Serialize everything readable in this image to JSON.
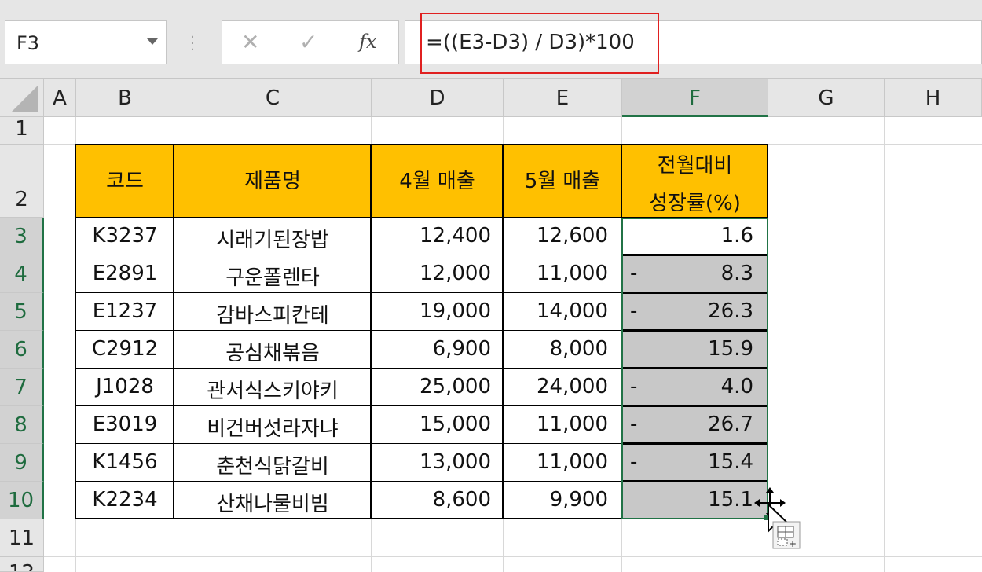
{
  "name_box": "F3",
  "formula_bar": {
    "cancel_icon": "✕",
    "enter_icon": "✓",
    "fx_label": "fx",
    "formula": "=((E3-D3) / D3)*100"
  },
  "columns": [
    "A",
    "B",
    "C",
    "D",
    "E",
    "F",
    "G",
    "H"
  ],
  "rows": [
    "1",
    "2",
    "3",
    "4",
    "5",
    "6",
    "7",
    "8",
    "9",
    "10",
    "11",
    "12"
  ],
  "table": {
    "headers": [
      "코드",
      "제품명",
      "4월 매출",
      "5월 매출",
      "전월대비",
      "성장률(%)"
    ],
    "rows": [
      {
        "code": "K3237",
        "name": "시래기된장밥",
        "apr": "12,400",
        "may": "12,600",
        "neg": "",
        "growth": "1.6"
      },
      {
        "code": "E2891",
        "name": "구운폴렌타",
        "apr": "12,000",
        "may": "11,000",
        "neg": "-",
        "growth": "8.3"
      },
      {
        "code": "E1237",
        "name": "감바스피칸테",
        "apr": "19,000",
        "may": "14,000",
        "neg": "-",
        "growth": "26.3"
      },
      {
        "code": "C2912",
        "name": "공심채볶음",
        "apr": "6,900",
        "may": "8,000",
        "neg": "",
        "growth": "15.9"
      },
      {
        "code": "J1028",
        "name": "관서식스키야키",
        "apr": "25,000",
        "may": "24,000",
        "neg": "-",
        "growth": "4.0"
      },
      {
        "code": "E3019",
        "name": "비건버섯라자냐",
        "apr": "15,000",
        "may": "11,000",
        "neg": "-",
        "growth": "26.7"
      },
      {
        "code": "K1456",
        "name": "춘천식닭갈비",
        "apr": "13,000",
        "may": "11,000",
        "neg": "-",
        "growth": "15.4"
      },
      {
        "code": "K2234",
        "name": "산채나물비빔",
        "apr": "8,600",
        "may": "9,900",
        "neg": "",
        "growth": "15.1"
      }
    ]
  },
  "colors": {
    "header_fill": "#ffc000",
    "selection": "#217346",
    "highlight": "#e02020"
  }
}
